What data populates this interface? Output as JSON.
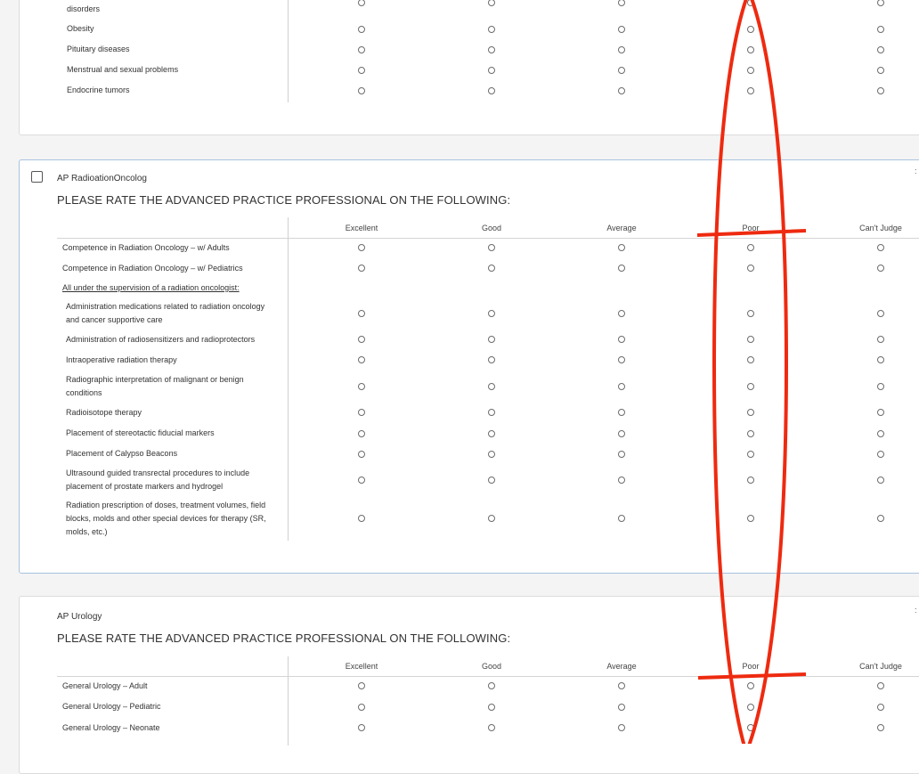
{
  "section_endocrine": {
    "rows": [
      "disorders",
      "Obesity",
      "Pituitary diseases",
      "Menstrual and sexual problems",
      "Endocrine tumors"
    ]
  },
  "section_radiation": {
    "title": "AP RadioationOncolog",
    "prompt": "PLEASE RATE THE ADVANCED PRACTICE PROFESSIONAL ON THE FOLLOWING:",
    "columns": [
      "Excellent",
      "Good",
      "Average",
      "Poor",
      "Can't Judge"
    ],
    "rows": [
      "Competence in Radiation Oncology – w/ Adults",
      "Competence in Radiation Oncology – w/ Pediatrics",
      "All under the supervision of a radiation oncologist:",
      "Administration medications related to radiation oncology and cancer supportive care",
      "Administration of radiosensitizers and radioprotectors",
      "Intraoperative radiation therapy",
      "Radiographic interpretation of malignant or benign conditions",
      "Radioisotope therapy",
      "Placement of stereotactic fiducial markers",
      "Placement of Calypso Beacons",
      "Ultrasound guided transrectal procedures to include placement of prostate markers and hydrogel",
      "Radiation prescription of doses, treatment volumes, field blocks, molds and other special devices for therapy (SR, molds, etc.)"
    ]
  },
  "section_urology": {
    "title": "AP Urology",
    "prompt": "PLEASE RATE THE ADVANCED PRACTICE PROFESSIONAL ON THE FOLLOWING:",
    "columns": [
      "Excellent",
      "Good",
      "Average",
      "Poor",
      "Can't Judge"
    ],
    "rows": [
      "General Urology – Adult",
      "General Urology – Pediatric",
      "General Urology – Neonate"
    ]
  },
  "annotation": {
    "color": "#ee2a10"
  }
}
